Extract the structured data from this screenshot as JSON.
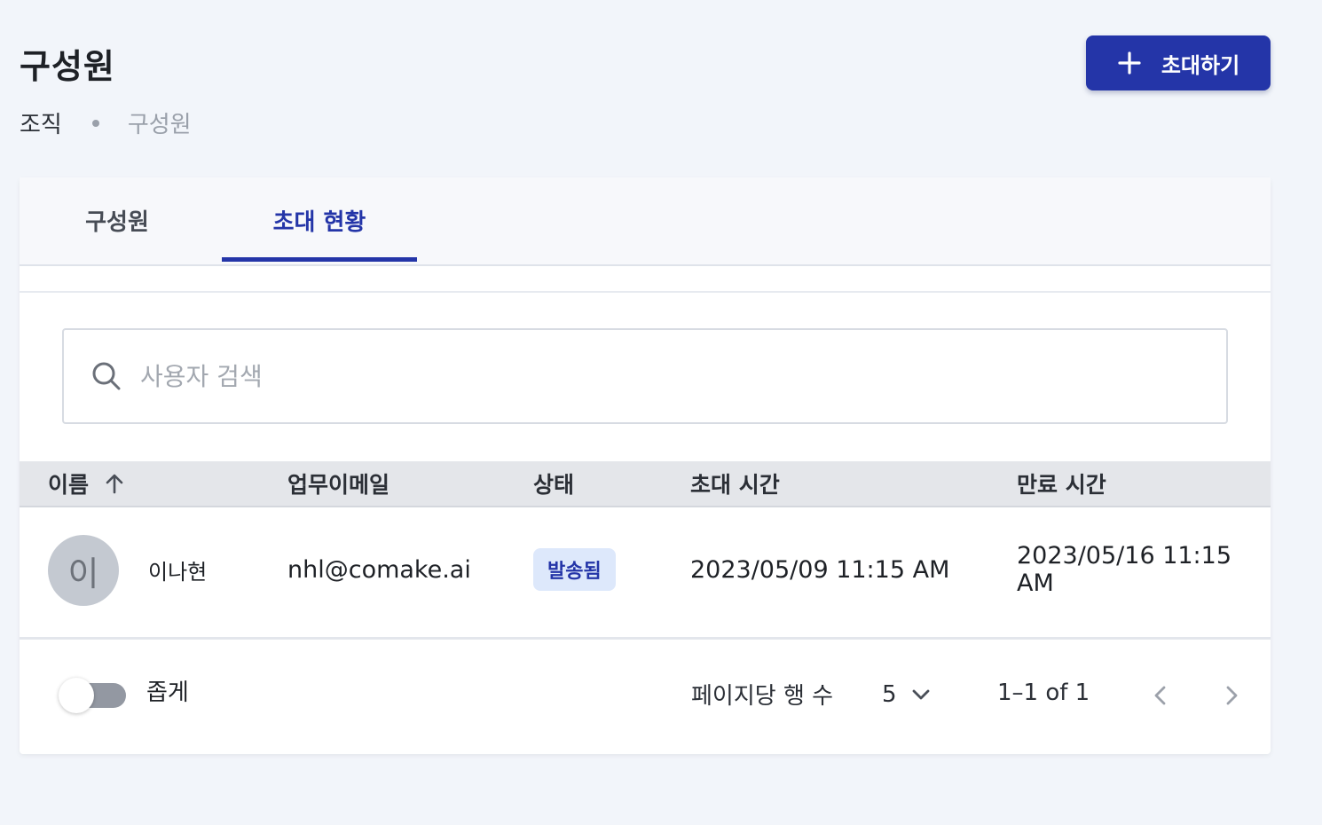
{
  "page": {
    "title": "구성원",
    "breadcrumb": [
      "조직",
      "구성원"
    ],
    "invite_button": "초대하기"
  },
  "tabs": [
    {
      "label": "구성원",
      "active": false
    },
    {
      "label": "초대 현황",
      "active": true
    }
  ],
  "search": {
    "placeholder": "사용자 검색",
    "value": ""
  },
  "table": {
    "columns": [
      "이름",
      "업무이메일",
      "상태",
      "초대 시간",
      "만료 시간"
    ],
    "sort": {
      "column": "이름",
      "direction": "asc"
    },
    "rows": [
      {
        "avatar_initial": "이",
        "name": "이나현",
        "email": "nhl@comake.ai",
        "status": "발송됨",
        "invited_at": "2023/05/09 11:15 AM",
        "expires_at": "2023/05/16 11:15 AM"
      }
    ]
  },
  "footer": {
    "dense_label": "좁게",
    "dense_enabled": false,
    "rows_per_page_label": "페이지당 행 수",
    "rows_per_page": "5",
    "range": "1–1 of 1"
  },
  "colors": {
    "accent": "#2435a8",
    "background": "#f2f5fa",
    "badge_bg": "#dde8fb"
  },
  "icons": [
    "plus-icon",
    "search-icon",
    "sort-arrow-up-icon",
    "chevron-down-icon",
    "chevron-left-icon",
    "chevron-right-icon"
  ]
}
